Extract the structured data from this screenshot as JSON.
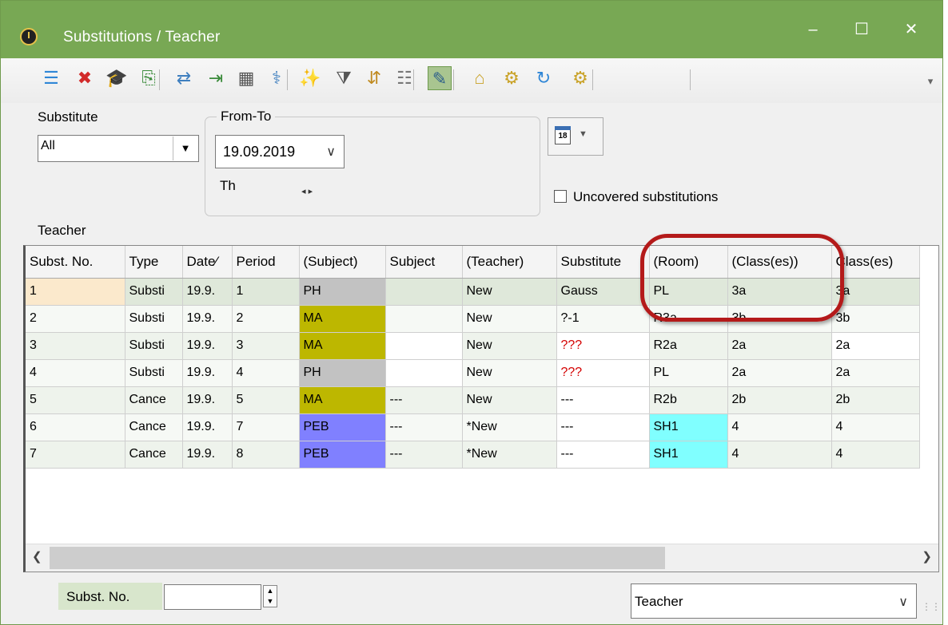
{
  "window": {
    "title": "Substitutions / Teacher"
  },
  "window_buttons": {
    "minimize": "–",
    "maximize": "☐",
    "close": "✕"
  },
  "toolbar": {
    "icons": [
      {
        "name": "list-icon",
        "glyph": "☰",
        "color": "#2f86d6"
      },
      {
        "name": "delete-icon",
        "glyph": "✖",
        "color": "#d22a2a"
      },
      {
        "name": "graduation-cap-icon",
        "glyph": "🎓",
        "color": "#333333"
      },
      {
        "name": "import-icon",
        "glyph": "⎘",
        "color": "#3a8a3a"
      },
      {
        "name": "swap-icon",
        "glyph": "⇄",
        "color": "#3f7fbf"
      },
      {
        "name": "export-icon",
        "glyph": "⇥",
        "color": "#3a8a3a"
      },
      {
        "name": "calculator-icon",
        "glyph": "▦",
        "color": "#555555"
      },
      {
        "name": "stethoscope-icon",
        "glyph": "⚕",
        "color": "#3f7fbf"
      },
      {
        "name": "wand-icon",
        "glyph": "✨",
        "color": "#555555"
      },
      {
        "name": "filter-icon",
        "glyph": "⧩",
        "color": "#555555"
      },
      {
        "name": "sort-icon",
        "glyph": "⇵",
        "color": "#c08a20"
      },
      {
        "name": "columns-icon",
        "glyph": "☷",
        "color": "#777777"
      },
      {
        "name": "palette-icon",
        "glyph": "✎",
        "color": "#2d5f8a"
      },
      {
        "name": "lock-icon",
        "glyph": "⌂",
        "color": "#c9a227"
      },
      {
        "name": "settings-doc-icon",
        "glyph": "⚙",
        "color": "#c9a227"
      },
      {
        "name": "refresh-icon",
        "glyph": "↻",
        "color": "#2f86d6"
      },
      {
        "name": "gear-icon",
        "glyph": "⚙",
        "color": "#c9a227"
      }
    ],
    "overflow": "▾"
  },
  "filters": {
    "substitute_label": "Substitute",
    "substitute_value": "All",
    "from_to_label": "From-To",
    "date_value": "19.09.2019",
    "day_label": "Th",
    "nav_arrows": "◂ ▸",
    "uncovered_label": "Uncovered substitutions",
    "teacher_label": "Teacher"
  },
  "table": {
    "columns": [
      "Subst. No.",
      "Type",
      "Date⁄",
      "Period",
      "(Subject)",
      "Subject",
      "(Teacher)",
      "Substitute",
      "(Room)",
      "(Class(es))",
      "Class(es)"
    ],
    "rows": [
      [
        "1",
        "Substi",
        "19.9.",
        "1",
        "PH",
        "",
        "New",
        "Gauss",
        "PL",
        "3a",
        "3a"
      ],
      [
        "2",
        "Substi",
        "19.9.",
        "2",
        "MA",
        "",
        "New",
        "?-1",
        "R3a",
        "3b",
        "3b"
      ],
      [
        "3",
        "Substi",
        "19.9.",
        "3",
        "MA",
        "",
        "New",
        "???",
        "R2a",
        "2a",
        "2a"
      ],
      [
        "4",
        "Substi",
        "19.9.",
        "4",
        "PH",
        "",
        "New",
        "???",
        "PL",
        "2a",
        "2a"
      ],
      [
        "5",
        "Cance",
        "19.9.",
        "5",
        "MA",
        "---",
        "New",
        "---",
        "R2b",
        "2b",
        "2b"
      ],
      [
        "6",
        "Cance",
        "19.9.",
        "7",
        "PEB",
        "---",
        "*New",
        "---",
        "SH1",
        "4",
        "4"
      ],
      [
        "7",
        "Cance",
        "19.9.",
        "8",
        "PEB",
        "---",
        "*New",
        "---",
        "SH1",
        "4",
        "4"
      ]
    ],
    "subject_colors": {
      "PH": "#c2c2c2",
      "MA": "#bdb700",
      "PEB": "#8080ff"
    },
    "room_highlight": {
      "SH1": "#80ffff"
    },
    "scroll_left": "❮",
    "scroll_right": "❯"
  },
  "footer": {
    "subst_no_label": "Subst. No.",
    "subst_no_value": "",
    "spin_up": "▲",
    "spin_down": "▼",
    "teacher_value": "Teacher",
    "teacher_chevron": "∨"
  }
}
